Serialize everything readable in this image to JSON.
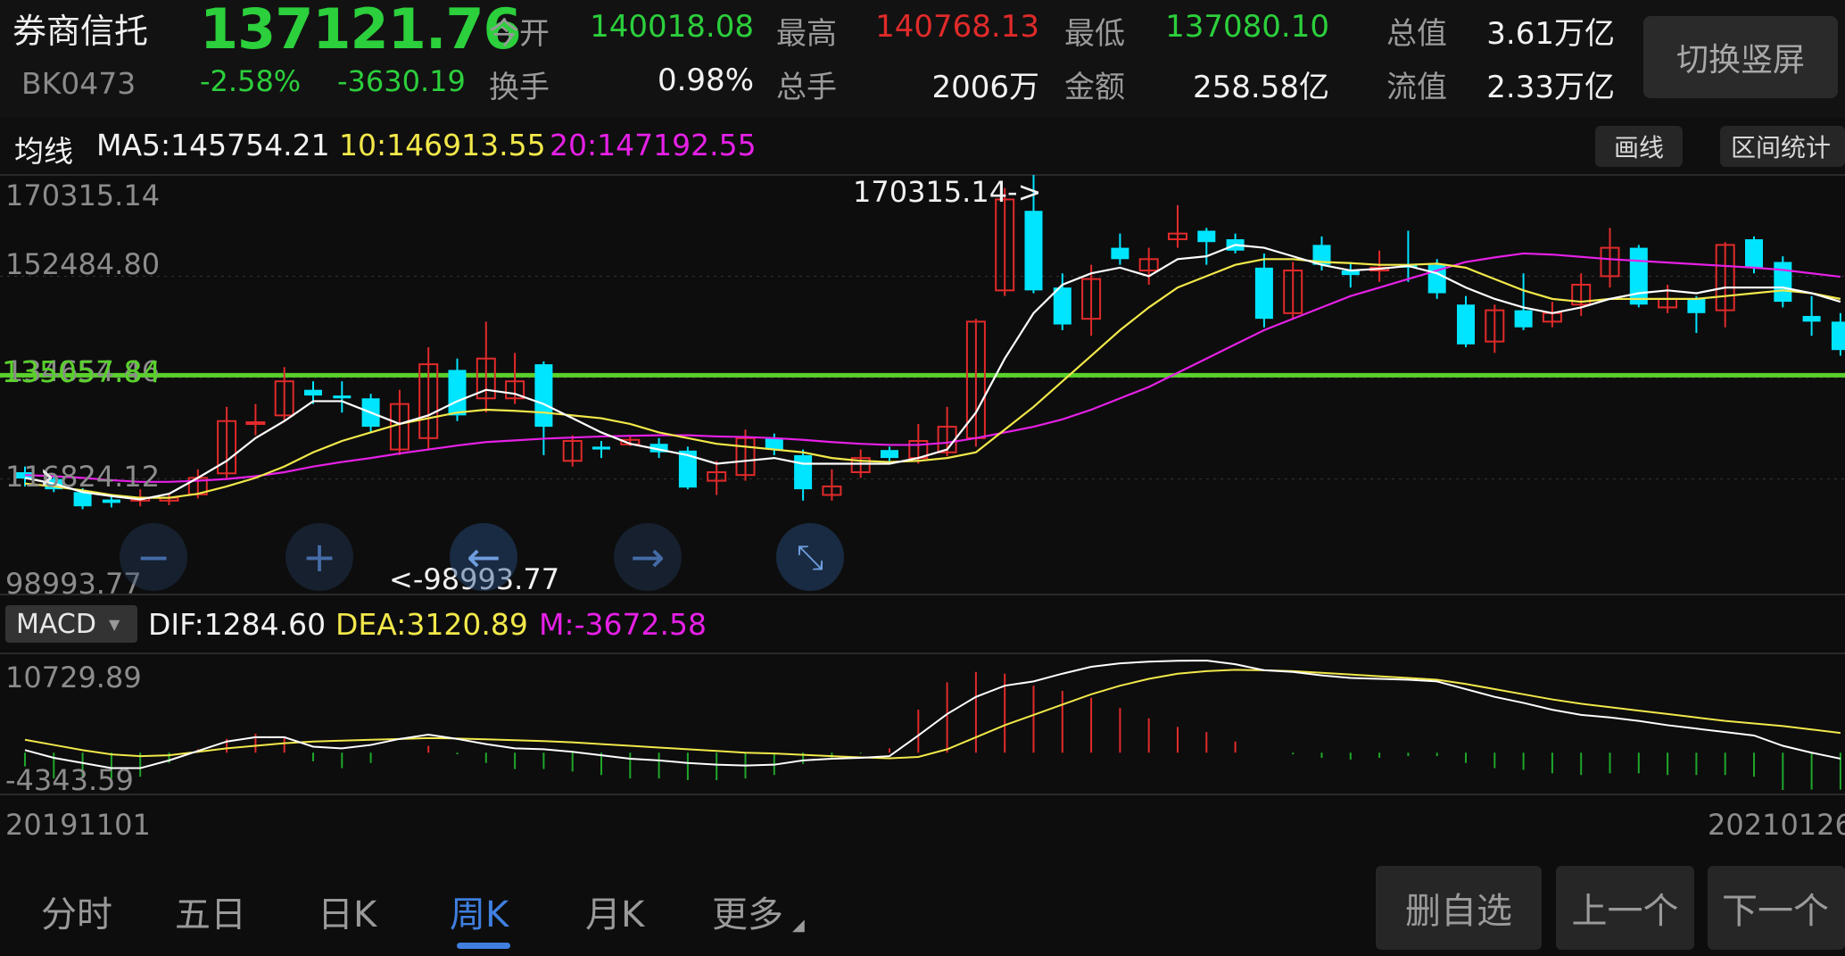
{
  "header": {
    "name": "券商信托",
    "code": "BK0473",
    "price": "137121.76",
    "change_pct": "-2.58%",
    "change_abs": "-3630.19",
    "stats": [
      {
        "label": "今开",
        "value": "140018.08",
        "color": "green"
      },
      {
        "label": "最高",
        "value": "140768.13",
        "color": "red"
      },
      {
        "label": "最低",
        "value": "137080.10",
        "color": "green"
      },
      {
        "label": "总值",
        "value": "3.61万亿",
        "color": "white"
      },
      {
        "label": "换手",
        "value": "0.98%",
        "color": "white"
      },
      {
        "label": "总手",
        "value": "2006万",
        "color": "white"
      },
      {
        "label": "金额",
        "value": "258.58亿",
        "color": "white"
      },
      {
        "label": "流值",
        "value": "2.33万亿",
        "color": "white"
      }
    ],
    "switch_label": "切换竖屏"
  },
  "ma_bar": {
    "title": "均线",
    "ma5": "MA5:145754.21",
    "ma10": "10:146913.55",
    "ma20": "20:147192.55",
    "draw_label": "画线",
    "range_label": "区间统计"
  },
  "price_axis": {
    "top": "170315.14",
    "l2": "152484.80",
    "l3": "134654.46",
    "l4": "116824.12",
    "bottom": "98993.77",
    "current_line": "135057.84",
    "max_annotation": "170315.14->",
    "min_annotation": "<-98993.77"
  },
  "macd": {
    "selector": "MACD",
    "dif": "DIF:1284.60",
    "dea": "DEA:3120.89",
    "m": "M:-3672.58",
    "top": "10729.89",
    "bottom": "-4343.59"
  },
  "dates": {
    "start": "20191101",
    "end": "20210126"
  },
  "tabs": [
    {
      "label": "分时",
      "active": false
    },
    {
      "label": "五日",
      "active": false
    },
    {
      "label": "日K",
      "active": false
    },
    {
      "label": "周K",
      "active": true
    },
    {
      "label": "月K",
      "active": false
    },
    {
      "label": "更多",
      "active": false
    }
  ],
  "buttons": {
    "remove": "删自选",
    "prev": "上一个",
    "next": "下一个"
  },
  "colors": {
    "up": "#e12a2a",
    "down": "#00e5ff",
    "ma5": "#ffffff",
    "ma10": "#f2e84a",
    "ma20": "#e620e6",
    "current_line": "#5ad12c",
    "active_tab": "#3f7fe0"
  },
  "chart_data": {
    "type": "candlestick",
    "ylim": [
      98993.77,
      170315.14
    ],
    "candles": [
      {
        "o": 118000,
        "c": 116900,
        "h": 119000,
        "l": 115500
      },
      {
        "o": 116800,
        "c": 115000,
        "h": 117300,
        "l": 114500
      },
      {
        "o": 114500,
        "c": 112000,
        "h": 115200,
        "l": 111500
      },
      {
        "o": 113200,
        "c": 112600,
        "h": 114000,
        "l": 111800
      },
      {
        "o": 113000,
        "c": 113500,
        "h": 115000,
        "l": 112000
      },
      {
        "o": 113000,
        "c": 113500,
        "h": 114400,
        "l": 112200
      },
      {
        "o": 114100,
        "c": 117000,
        "h": 118500,
        "l": 113400
      },
      {
        "o": 117800,
        "c": 127000,
        "h": 129500,
        "l": 117000
      },
      {
        "o": 126500,
        "c": 126800,
        "h": 130000,
        "l": 124500
      },
      {
        "o": 128000,
        "c": 134000,
        "h": 136500,
        "l": 127000
      },
      {
        "o": 132500,
        "c": 131500,
        "h": 134000,
        "l": 130000
      },
      {
        "o": 131500,
        "c": 131000,
        "h": 134000,
        "l": 128500
      },
      {
        "o": 131000,
        "c": 126000,
        "h": 131800,
        "l": 125000
      },
      {
        "o": 122000,
        "c": 130000,
        "h": 132500,
        "l": 121000
      },
      {
        "o": 124000,
        "c": 137000,
        "h": 140000,
        "l": 122000
      },
      {
        "o": 136000,
        "c": 128000,
        "h": 138000,
        "l": 127000
      },
      {
        "o": 131000,
        "c": 138000,
        "h": 144500,
        "l": 128500
      },
      {
        "o": 131000,
        "c": 134000,
        "h": 139000,
        "l": 130000
      },
      {
        "o": 137000,
        "c": 126000,
        "h": 137500,
        "l": 121000
      },
      {
        "o": 120000,
        "c": 123500,
        "h": 124500,
        "l": 119000
      },
      {
        "o": 122500,
        "c": 122000,
        "h": 123500,
        "l": 120500
      },
      {
        "o": 122900,
        "c": 123700,
        "h": 124200,
        "l": 122600
      },
      {
        "o": 123000,
        "c": 121500,
        "h": 124000,
        "l": 120500
      },
      {
        "o": 121800,
        "c": 115300,
        "h": 122500,
        "l": 115000
      },
      {
        "o": 116500,
        "c": 118000,
        "h": 120000,
        "l": 114000
      },
      {
        "o": 117500,
        "c": 124000,
        "h": 125500,
        "l": 116500
      },
      {
        "o": 124000,
        "c": 122000,
        "h": 124800,
        "l": 121000
      },
      {
        "o": 121000,
        "c": 115000,
        "h": 122000,
        "l": 113000
      },
      {
        "o": 114000,
        "c": 115500,
        "h": 118500,
        "l": 113000
      },
      {
        "o": 118000,
        "c": 120500,
        "h": 122000,
        "l": 117000
      },
      {
        "o": 121900,
        "c": 120500,
        "h": 122500,
        "l": 119500
      },
      {
        "o": 120500,
        "c": 123500,
        "h": 126500,
        "l": 119500
      },
      {
        "o": 121500,
        "c": 126000,
        "h": 129500,
        "l": 120800
      },
      {
        "o": 124000,
        "c": 144500,
        "h": 145000,
        "l": 122500
      },
      {
        "o": 150000,
        "c": 166000,
        "h": 168000,
        "l": 149000
      },
      {
        "o": 164000,
        "c": 150000,
        "h": 170315.14,
        "l": 149500
      },
      {
        "o": 150500,
        "c": 144000,
        "h": 153000,
        "l": 143000
      },
      {
        "o": 145000,
        "c": 152000,
        "h": 154500,
        "l": 142000
      },
      {
        "o": 157500,
        "c": 155500,
        "h": 160000,
        "l": 154500
      },
      {
        "o": 153500,
        "c": 155500,
        "h": 157500,
        "l": 151000
      },
      {
        "o": 159000,
        "c": 160000,
        "h": 165000,
        "l": 157500
      },
      {
        "o": 160500,
        "c": 158500,
        "h": 161000,
        "l": 154500
      },
      {
        "o": 159000,
        "c": 157000,
        "h": 160000,
        "l": 156500
      },
      {
        "o": 154000,
        "c": 145000,
        "h": 156500,
        "l": 143500
      },
      {
        "o": 146000,
        "c": 153500,
        "h": 155000,
        "l": 145000
      },
      {
        "o": 158000,
        "c": 154500,
        "h": 159500,
        "l": 153500
      },
      {
        "o": 153500,
        "c": 152700,
        "h": 155000,
        "l": 150500
      },
      {
        "o": 153500,
        "c": 154000,
        "h": 157000,
        "l": 151500
      },
      {
        "o": 154500,
        "c": 154000,
        "h": 160500,
        "l": 151500
      },
      {
        "o": 154500,
        "c": 149500,
        "h": 155500,
        "l": 148500
      },
      {
        "o": 147500,
        "c": 140500,
        "h": 149000,
        "l": 140000
      },
      {
        "o": 141000,
        "c": 146500,
        "h": 147500,
        "l": 139000
      },
      {
        "o": 146500,
        "c": 143500,
        "h": 153000,
        "l": 143000
      },
      {
        "o": 144500,
        "c": 146000,
        "h": 148000,
        "l": 143500
      },
      {
        "o": 147500,
        "c": 151000,
        "h": 153000,
        "l": 145500
      },
      {
        "o": 152500,
        "c": 157500,
        "h": 161000,
        "l": 150500
      },
      {
        "o": 157500,
        "c": 147500,
        "h": 158000,
        "l": 147000
      },
      {
        "o": 147000,
        "c": 148500,
        "h": 151000,
        "l": 146000
      },
      {
        "o": 148500,
        "c": 146000,
        "h": 149000,
        "l": 142500
      },
      {
        "o": 146500,
        "c": 158000,
        "h": 158500,
        "l": 143500
      },
      {
        "o": 159000,
        "c": 154000,
        "h": 159500,
        "l": 153000
      },
      {
        "o": 155000,
        "c": 148000,
        "h": 156000,
        "l": 147000
      },
      {
        "o": 145500,
        "c": 144500,
        "h": 149000,
        "l": 142000
      },
      {
        "o": 144500,
        "c": 139500,
        "h": 146000,
        "l": 138500
      }
    ],
    "ma5": [
      117000,
      116000,
      114500,
      113800,
      113200,
      114200,
      117000,
      120000,
      124000,
      127000,
      130500,
      130500,
      128500,
      126500,
      128000,
      130500,
      132500,
      131800,
      130000,
      127500,
      125000,
      123000,
      122000,
      121000,
      119500,
      120000,
      120500,
      119500,
      119500,
      119500,
      119500,
      120500,
      122000,
      128500,
      138000,
      146000,
      151000,
      153000,
      154000,
      152500,
      155500,
      156000,
      158000,
      157500,
      156000,
      154500,
      153500,
      153800,
      154300,
      153000,
      150500,
      148500,
      147000,
      146000,
      147000,
      148500,
      149500,
      150000,
      149500,
      150500,
      150500,
      150500,
      149500,
      148000
    ],
    "ma10": [
      116000,
      115500,
      114800,
      114000,
      113500,
      113500,
      114200,
      115500,
      117000,
      119000,
      121500,
      123500,
      125000,
      126500,
      127500,
      128500,
      129000,
      128800,
      128500,
      128000,
      127500,
      126500,
      125000,
      124000,
      123000,
      122500,
      122000,
      121500,
      120500,
      120000,
      119800,
      120000,
      120500,
      121500,
      125500,
      129500,
      134000,
      138500,
      143000,
      147000,
      150500,
      152500,
      154500,
      155500,
      155500,
      155000,
      154800,
      154500,
      154500,
      154700,
      154000,
      152000,
      150000,
      148500,
      148000,
      148500,
      148500,
      148500,
      148500,
      149000,
      149500,
      150000,
      149500,
      148500
    ],
    "ma20": [
      117500,
      117300,
      117000,
      116600,
      116300,
      116300,
      116500,
      116800,
      117300,
      118000,
      119000,
      119800,
      120500,
      121300,
      122000,
      122700,
      123300,
      123600,
      123900,
      124100,
      124300,
      124400,
      124500,
      124500,
      124300,
      124200,
      124000,
      123700,
      123300,
      123000,
      122800,
      122800,
      123200,
      124000,
      125000,
      126000,
      127300,
      129000,
      131000,
      133000,
      135500,
      138000,
      140500,
      143000,
      145000,
      147000,
      149000,
      150500,
      152000,
      153500,
      155000,
      155800,
      156500,
      156300,
      155900,
      155500,
      155200,
      154900,
      154600,
      154300,
      154000,
      153600,
      153000,
      152400
    ],
    "macd_dif": [
      300,
      -600,
      -1200,
      -1800,
      -1800,
      -900,
      200,
      1300,
      1800,
      1800,
      700,
      500,
      900,
      1600,
      2100,
      1600,
      1000,
      500,
      400,
      100,
      -300,
      -700,
      -900,
      -1200,
      -1400,
      -1500,
      -1400,
      -900,
      -700,
      -600,
      -400,
      2000,
      4500,
      6500,
      7800,
      8300,
      9200,
      10000,
      10400,
      10600,
      10700,
      10729.89,
      10300,
      9600,
      9400,
      9000,
      8700,
      8600,
      8500,
      8300,
      7400,
      6500,
      5800,
      5000,
      4400,
      4100,
      3700,
      3200,
      2800,
      2400,
      2000,
      800,
      0,
      -700
    ],
    "macd_dea": [
      1500,
      900,
      300,
      -200,
      -400,
      -300,
      100,
      500,
      800,
      1100,
      1300,
      1400,
      1500,
      1600,
      1700,
      1650,
      1550,
      1450,
      1350,
      1200,
      1000,
      800,
      600,
      400,
      200,
      0,
      -100,
      -250,
      -400,
      -550,
      -650,
      -500,
      400,
      1800,
      3200,
      4400,
      5600,
      6800,
      7800,
      8600,
      9200,
      9500,
      9650,
      9600,
      9500,
      9300,
      9100,
      8900,
      8700,
      8500,
      8000,
      7400,
      6800,
      6200,
      5700,
      5300,
      4900,
      4500,
      4100,
      3700,
      3400,
      3100,
      2700,
      2300
    ],
    "macd_m": [
      -1600,
      -3000,
      -3000,
      -3000,
      -2800,
      -1200,
      400,
      1600,
      2200,
      1800,
      -1000,
      -1800,
      -1200,
      0,
      800,
      -200,
      -1200,
      -1900,
      -1900,
      -2200,
      -2600,
      -3000,
      -3000,
      -3200,
      -3200,
      -3000,
      -2600,
      -1300,
      -600,
      -100,
      500,
      5000,
      8200,
      9400,
      9200,
      7800,
      7200,
      6400,
      5200,
      4000,
      3000,
      2400,
      1300,
      0,
      -200,
      -600,
      -800,
      -600,
      -400,
      -400,
      -1200,
      -1800,
      -2000,
      -2400,
      -2600,
      -2400,
      -2400,
      -2600,
      -2600,
      -2600,
      -2800,
      -4343.59,
      -4300,
      -4300
    ]
  }
}
